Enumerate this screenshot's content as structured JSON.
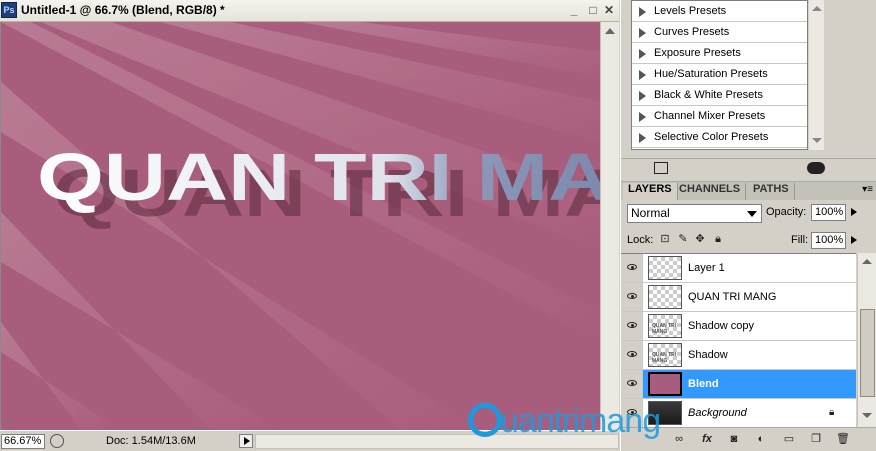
{
  "document": {
    "title": "Untitled-1 @ 66.7% (Blend, RGB/8) *",
    "app_icon": "Ps",
    "canvas_text": "QUAN TRI MANG",
    "canvas_color": "#a95d7c",
    "zoom": "66.67%",
    "doc_info": "Doc: 1.54M/13.6M"
  },
  "presets": {
    "items": [
      "Levels Presets",
      "Curves Presets",
      "Exposure Presets",
      "Hue/Saturation Presets",
      "Black & White Presets",
      "Channel Mixer Presets",
      "Selective Color Presets"
    ]
  },
  "layers_panel": {
    "tabs": [
      "LAYERS",
      "CHANNELS",
      "PATHS"
    ],
    "active_tab": "LAYERS",
    "blend_mode": "Normal",
    "opacity_label": "Opacity:",
    "opacity": "100%",
    "lock_label": "Lock:",
    "fill_label": "Fill:",
    "fill": "100%",
    "layers": [
      {
        "name": "Layer 1",
        "thumb": "transparent",
        "selected": false
      },
      {
        "name": "QUAN TRI MANG",
        "thumb": "transparent",
        "selected": false
      },
      {
        "name": "Shadow copy",
        "thumb": "text",
        "selected": false
      },
      {
        "name": "Shadow",
        "thumb": "text",
        "selected": false
      },
      {
        "name": "Blend",
        "thumb": "blend",
        "selected": true
      },
      {
        "name": "Background",
        "thumb": "background",
        "selected": false,
        "locked": true
      }
    ],
    "selected_color": "#3399ff"
  },
  "watermark": {
    "text": "uantrimang",
    "color": "#1a9be0"
  }
}
